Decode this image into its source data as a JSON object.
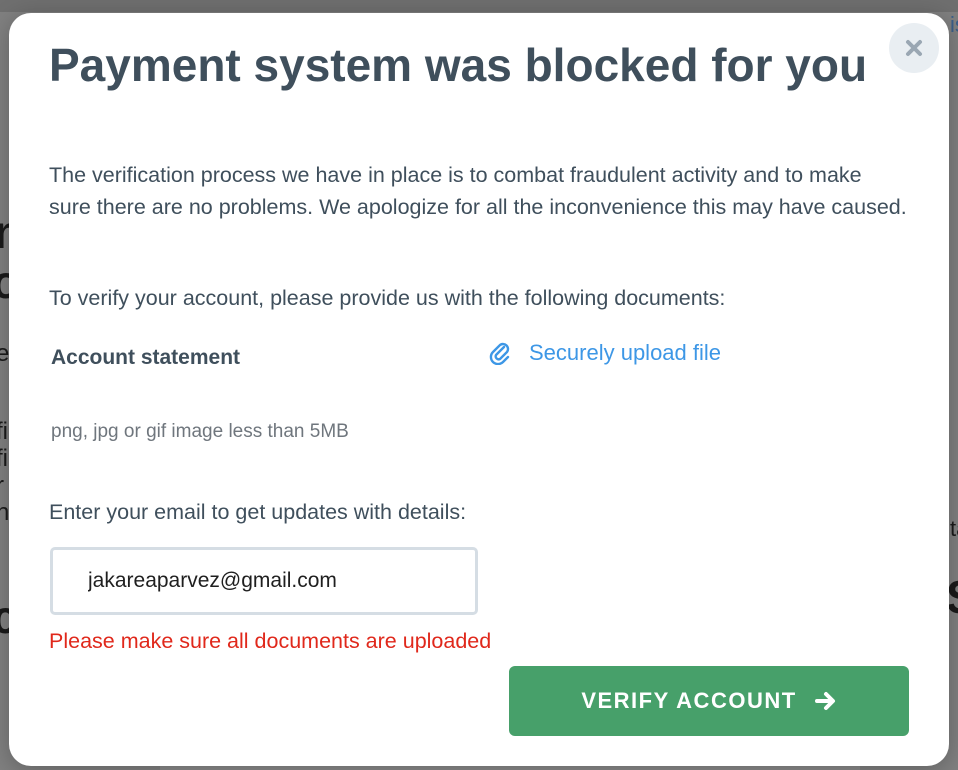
{
  "modal": {
    "title": "Payment system was blocked for you",
    "intro": "The verification process we have in place is to combat fraudulent activity and to make sure there are no problems. We apologize for all the inconvenience this may have caused.",
    "documents_prompt": "To verify your account, please provide us with the following documents:",
    "document": {
      "label": "Account statement",
      "upload_link": "Securely upload file",
      "upload_icon": "paperclip-icon",
      "hint": "png, jpg or gif image less than 5MB"
    },
    "email": {
      "label": "Enter your email to get updates with details:",
      "value": "jakareaparvez@gmail.com"
    },
    "error": "Please make sure all documents are uploaded",
    "verify_button": {
      "label": "VERIFY ACCOUNT",
      "icon": "arrow-right-icon"
    },
    "close_icon": "close-icon"
  },
  "colors": {
    "title_text": "#3f4f5c",
    "link": "#3d97e6",
    "error": "#e0281b",
    "button": "#47a06a",
    "close_bg": "#e9eef2"
  }
}
